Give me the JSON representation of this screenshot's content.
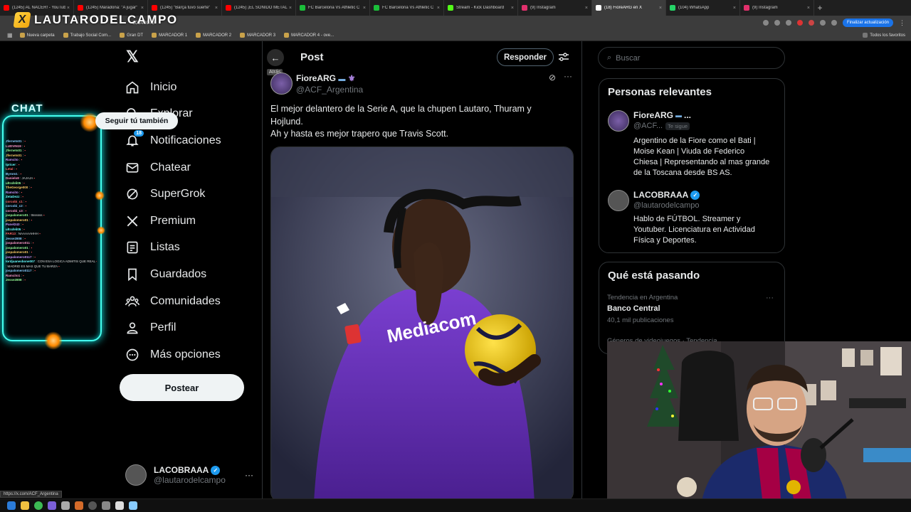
{
  "colors": {
    "accent": "#1d9bf0",
    "background": "#000000",
    "text": "#e7e9ea",
    "muted": "#71767b",
    "chat_glow": "#44eeee"
  },
  "browser": {
    "tabs": [
      {
        "label": "(1245) AL NACER! - YouTube",
        "color": "#ff0000"
      },
      {
        "label": "(1245) Maradona: \"A jugar\"",
        "color": "#ff0000"
      },
      {
        "label": "(1245) \"Barça tuvo suerte\"",
        "color": "#ff0000"
      },
      {
        "label": "(1245) ¡EL SONIDO METAL",
        "color": "#ff0000"
      },
      {
        "label": "FC Barcelona Vs Athletic C",
        "color": "#1bbf3a"
      },
      {
        "label": "FC Barcelona Vs Athletic C",
        "color": "#1bbf3a"
      },
      {
        "label": "Stream - Kick Dashboard",
        "color": "#53fc18"
      },
      {
        "label": "(9) Instagram",
        "color": "#e1306c"
      },
      {
        "label": "(18) FioreARG en X",
        "color": "#ffffff"
      },
      {
        "label": "(104) WhatsApp",
        "color": "#25d366"
      },
      {
        "label": "(9) Instagram",
        "color": "#e1306c"
      }
    ],
    "url_fragment": "60540079",
    "update_label": "Finalizar actualización",
    "bookmarks": [
      "Nueva carpeta",
      "Trabajo Social Com...",
      "Gran DT",
      "MARCADOR 1",
      "MARCADOR 2",
      "MARCADOR 3",
      "MARCADOR 4 - ove..."
    ],
    "all_bookmarks": "Todos los favoritos",
    "status_url": "https://x.com/ACF_Argentina"
  },
  "overlay": {
    "brand": "LAUTARODELCAMPO",
    "chat_title": "CHAT",
    "chat_messages": [
      {
        "user": "Jfernets01",
        "text": ""
      },
      {
        "user": "LUDVIN19",
        "text": ""
      },
      {
        "user": "Jfernets01",
        "text": ""
      },
      {
        "user": "Jfernets01",
        "text": ""
      },
      {
        "user": "Ramcito",
        "text": ""
      },
      {
        "user": "tpricer",
        "text": ""
      },
      {
        "user": "Letal",
        "text": ""
      },
      {
        "user": "Byrom1",
        "text": ""
      },
      {
        "user": "Danielo8",
        "text": "JAJAJA"
      },
      {
        "user": "ultrafeli05",
        "text": ""
      },
      {
        "user": "TheGeorge000",
        "text": ""
      },
      {
        "user": "Ramcito",
        "text": ""
      },
      {
        "user": "ZetaDezz",
        "text": ""
      },
      {
        "user": "corcobi_c1",
        "text": ""
      },
      {
        "user": "corcobi_c2",
        "text": ""
      },
      {
        "user": "corcobi_c3",
        "text": ""
      },
      {
        "user": "jospalomero01",
        "text": "ttssssss"
      },
      {
        "user": "jospalomero01",
        "text": ""
      },
      {
        "user": "Panel243",
        "text": ""
      },
      {
        "user": "ultrafeli05",
        "text": ""
      },
      {
        "user": "FAR13",
        "text": "NAAAAAHHH"
      },
      {
        "user": "Jesse2808",
        "text": ""
      },
      {
        "user": "jospalomero011",
        "text": ""
      },
      {
        "user": "jospalomero01",
        "text": ""
      },
      {
        "user": "jospalomero01",
        "text": ""
      },
      {
        "user": "jospalomero0117",
        "text": ""
      },
      {
        "user": "lordjuanesbone007",
        "text": "CON ESA LOGICA ADMITIS QUE REAL"
      },
      {
        "user": "",
        "text": "MADRID ES MAS QUE TU BARZA"
      },
      {
        "user": "jospalomero0117",
        "text": ""
      },
      {
        "user": "Ramcito1",
        "text": ""
      },
      {
        "user": "Jesse2808",
        "text": ""
      }
    ]
  },
  "sidebar": {
    "nav": [
      {
        "name": "home",
        "label": "Inicio",
        "icon": "home-icon"
      },
      {
        "name": "explore",
        "label": "Explorar",
        "icon": "search-icon"
      },
      {
        "name": "notifications",
        "label": "Notificaciones",
        "icon": "bell-icon",
        "badge": "18"
      },
      {
        "name": "chat",
        "label": "Chatear",
        "icon": "mail-icon"
      },
      {
        "name": "supergrok",
        "label": "SuperGrok",
        "icon": "grok-icon"
      },
      {
        "name": "premium",
        "label": "Premium",
        "icon": "x-icon"
      },
      {
        "name": "lists",
        "label": "Listas",
        "icon": "list-icon"
      },
      {
        "name": "bookmarks",
        "label": "Guardados",
        "icon": "bookmark-icon"
      },
      {
        "name": "communities",
        "label": "Comunidades",
        "icon": "people-icon"
      },
      {
        "name": "profile",
        "label": "Perfil",
        "icon": "person-icon"
      },
      {
        "name": "more",
        "label": "Más opciones",
        "icon": "more-circle-icon"
      }
    ],
    "post_label": "Postear",
    "account": {
      "name": "LACOBRAAA",
      "handle": "@lautarodelcampo",
      "more": "···"
    }
  },
  "main": {
    "title": "Post",
    "back_tooltip": "Atrás",
    "reply_label": "Responder",
    "post": {
      "author": "FioreARG",
      "handle": "@ACF_Argentina",
      "more": "···",
      "text": [
        "El mejor delantero de la Serie A, que la chupen Lautaro, Thuram y",
        "Hojlund.",
        "Ah y hasta es mejor trapero que Travis Scott."
      ],
      "image_jersey_text": "Mediacom"
    }
  },
  "right": {
    "search_placeholder": "Buscar",
    "people_title": "Personas relevantes",
    "people": [
      {
        "name": "FioreARG",
        "handle": "@ACF...",
        "follows_you": "Te sigue",
        "button": "Seguir tú también",
        "bio": [
          "Argentino de la Fiore como el Bati |",
          "Moise Kean | Viuda de Federico",
          "Chiesa | Representando al mas grande",
          "de la Toscana desde BS AS."
        ]
      },
      {
        "name": "LACOBRAAA",
        "handle": "@lautarodelcampo",
        "bio": [
          "Hablo de FÚTBOL. Streamer y",
          "Youtuber. Licenciatura en Actividad",
          "Física y Deportes."
        ]
      }
    ],
    "trends_title": "Qué está pasando",
    "trends": [
      {
        "meta": "Tendencia en Argentina",
        "name": "Banco Central",
        "count": "40,1 mil publicaciones"
      },
      {
        "meta": "Géneros de videojuegos · Tendencia"
      }
    ],
    "trend_more": "···"
  }
}
